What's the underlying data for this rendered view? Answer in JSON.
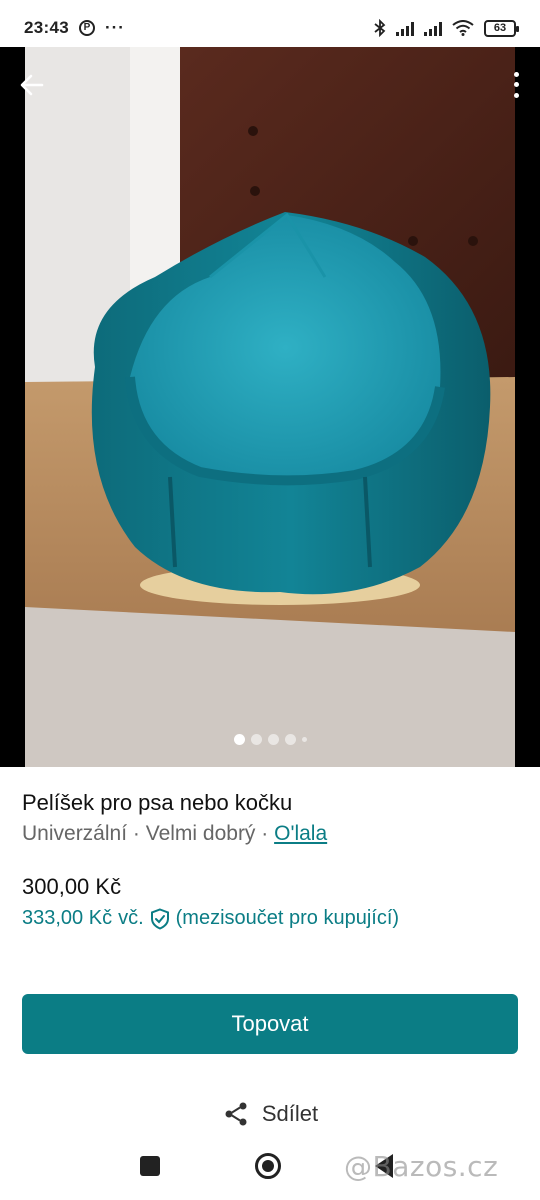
{
  "status_bar": {
    "time": "23:43",
    "more": "···",
    "battery": "63",
    "icons": [
      "pinterest-icon",
      "bluetooth-icon",
      "signal-icon",
      "wifi-icon",
      "battery-icon"
    ]
  },
  "gallery": {
    "image_count": 5,
    "active_index": 0,
    "icons": [
      "back-arrow-icon",
      "more-vert-icon"
    ]
  },
  "listing": {
    "title": "Pelíšek pro psa nebo kočku",
    "size": "Univerzální",
    "separator": " · ",
    "condition": "Velmi dobrý",
    "brand": "O'lala",
    "price": "300,00 Kč",
    "buyer_price": "333,00 Kč",
    "buyer_price_incl": "vč.",
    "buyer_price_note": "(mezisoučet pro kupující)"
  },
  "actions": {
    "primary_label": "Topovat",
    "share_label": "Sdílet"
  },
  "nav_bar": {
    "icons": [
      "recents-icon",
      "home-icon",
      "back-icon"
    ]
  },
  "watermark": "@Bazos.cz",
  "colors": {
    "accent": "#0b7d85",
    "text": "#111111",
    "muted": "#666666"
  }
}
